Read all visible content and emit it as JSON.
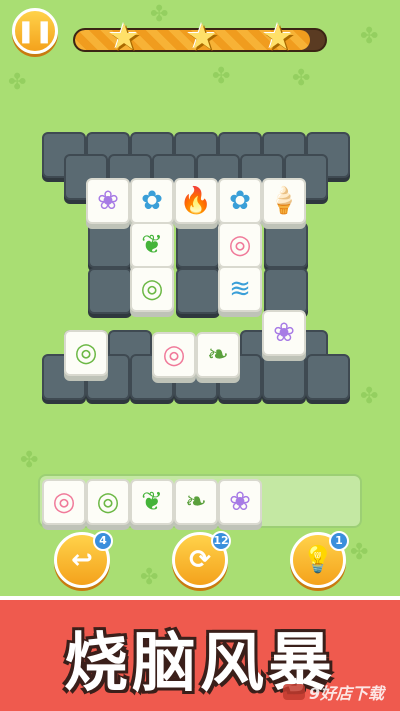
{
  "top_bar": {
    "pause_icon": "pause-icon",
    "stars": 3,
    "progress": 0.94
  },
  "board": {
    "tiles": [
      {
        "icon": "flower",
        "glyph": "❀",
        "color": "#a77be5"
      },
      {
        "icon": "cotton",
        "glyph": "✿",
        "color": "#3a9fd8"
      },
      {
        "icon": "campfire",
        "glyph": "🔥",
        "color": "#f0603a"
      },
      {
        "icon": "cotton",
        "glyph": "✿",
        "color": "#3a9fd8"
      },
      {
        "icon": "ice-cream",
        "glyph": "🍦",
        "color": "#f28fb4"
      },
      {
        "icon": "pea-pod",
        "glyph": "❦",
        "color": "#45b43a"
      },
      {
        "icon": "pink-roll-cake",
        "glyph": "◎",
        "color": "#f07a9a"
      },
      {
        "icon": "green-roll-cake",
        "glyph": "◎",
        "color": "#6cb845"
      },
      {
        "icon": "wave",
        "glyph": "≋",
        "color": "#3a9fd8"
      },
      {
        "icon": "flower",
        "glyph": "❀",
        "color": "#a77be5"
      },
      {
        "icon": "green-roll-cake",
        "glyph": "◎",
        "color": "#6cb845"
      },
      {
        "icon": "pink-roll-cake",
        "glyph": "◎",
        "color": "#f07a9a"
      },
      {
        "icon": "dumpling",
        "glyph": "❧",
        "color": "#5aa03c"
      }
    ]
  },
  "tray": {
    "tiles": [
      {
        "icon": "pink-roll-cake",
        "glyph": "◎",
        "color": "#f07a9a"
      },
      {
        "icon": "green-roll-cake",
        "glyph": "◎",
        "color": "#6cb845"
      },
      {
        "icon": "pea-pod",
        "glyph": "❦",
        "color": "#45b43a"
      },
      {
        "icon": "dumpling",
        "glyph": "❧",
        "color": "#5aa03c"
      },
      {
        "icon": "flower",
        "glyph": "❀",
        "color": "#a77be5"
      }
    ]
  },
  "tools": [
    {
      "name": "undo",
      "icon": "undo-arrow-icon",
      "glyph": "↩",
      "count": "4"
    },
    {
      "name": "shuffle",
      "icon": "shuffle-icon",
      "glyph": "⟳",
      "count": "12"
    },
    {
      "name": "hint",
      "icon": "lightbulb-icon",
      "glyph": "💡",
      "count": "1"
    }
  ],
  "banner": {
    "title": "烧脑风暴",
    "watermark": "9好店下载"
  }
}
